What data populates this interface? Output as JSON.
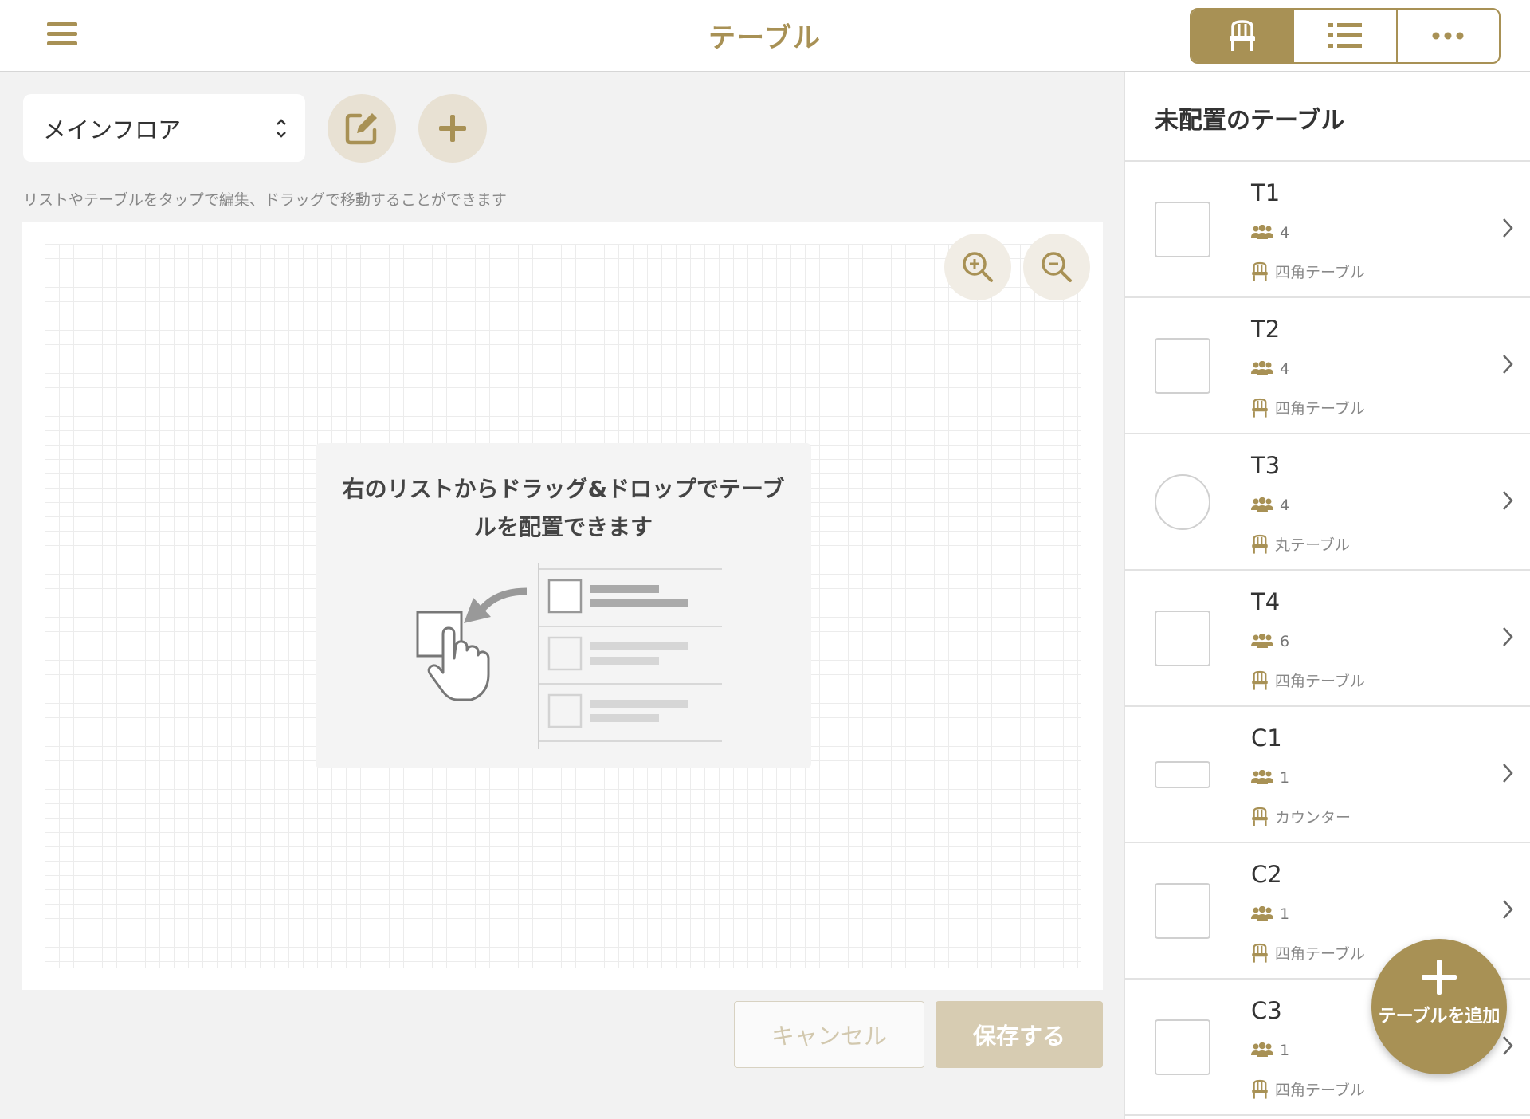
{
  "header": {
    "title": "テーブル",
    "menu_icon": "hamburger-icon",
    "view_toggle": [
      {
        "icon": "chair-icon",
        "active": true
      },
      {
        "icon": "list-icon",
        "active": false
      },
      {
        "icon": "more-icon",
        "active": false
      }
    ]
  },
  "toolbar": {
    "floor_selected": "メインフロア",
    "edit_icon": "edit-icon",
    "add_icon": "plus-icon"
  },
  "hint": "リストやテーブルをタップで編集、ドラッグで移動することができます",
  "canvas": {
    "zoom_in_icon": "zoom-in-icon",
    "zoom_out_icon": "zoom-out-icon",
    "guide_text": "右のリストからドラッグ&ドロップでテーブルを配置できます"
  },
  "footer": {
    "cancel_label": "キャンセル",
    "save_label": "保存する"
  },
  "panel": {
    "title": "未配置のテーブル",
    "items": [
      {
        "name": "T1",
        "seats": "4",
        "type": "四角テーブル",
        "shape": "square"
      },
      {
        "name": "T2",
        "seats": "4",
        "type": "四角テーブル",
        "shape": "square"
      },
      {
        "name": "T3",
        "seats": "4",
        "type": "丸テーブル",
        "shape": "round"
      },
      {
        "name": "T4",
        "seats": "6",
        "type": "四角テーブル",
        "shape": "square"
      },
      {
        "name": "C1",
        "seats": "1",
        "type": "カウンター",
        "shape": "counter"
      },
      {
        "name": "C2",
        "seats": "1",
        "type": "四角テーブル",
        "shape": "square"
      },
      {
        "name": "C3",
        "seats": "1",
        "type": "四角テーブル",
        "shape": "square"
      }
    ]
  },
  "fab": {
    "label": "テーブルを追加"
  },
  "colors": {
    "accent": "#a89155",
    "accent_light": "#e8e1d3",
    "disabled": "#d7ccb2"
  }
}
